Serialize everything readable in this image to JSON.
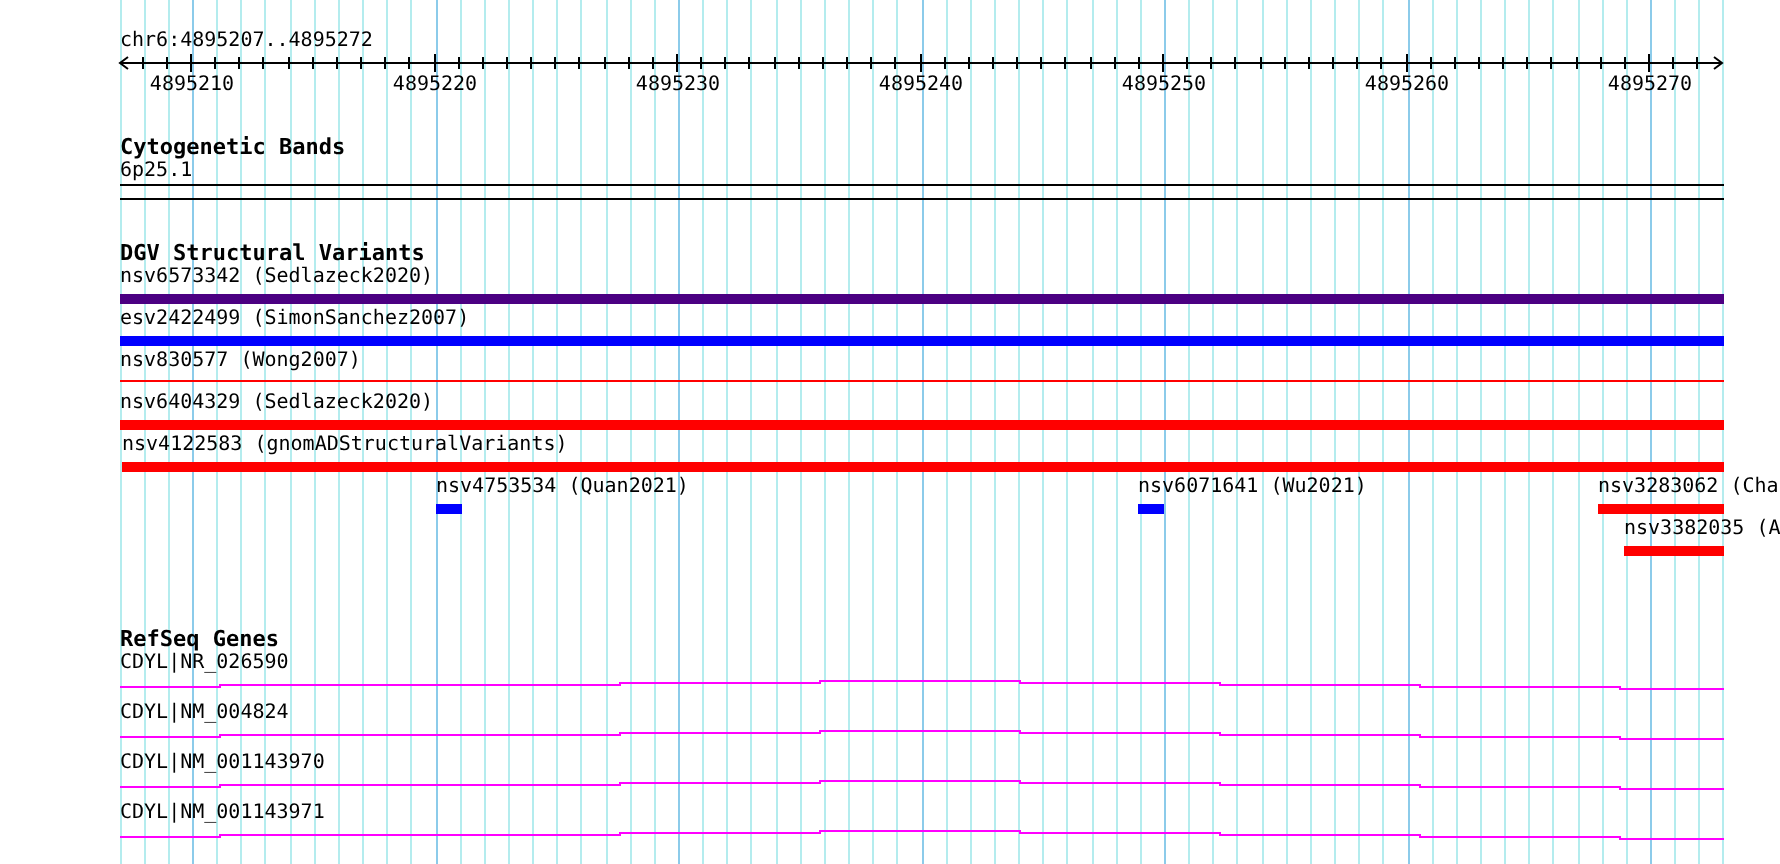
{
  "location": "chr6:4895207..4895272",
  "ruler": {
    "ticks": [
      "4895210",
      "4895220",
      "4895230",
      "4895240",
      "4895250",
      "4895260",
      "4895270"
    ]
  },
  "tracks": [
    {
      "kind": "bands",
      "title": "Cytogenetic Bands",
      "features": [
        {
          "label": "6p25.1"
        }
      ]
    },
    {
      "kind": "variants",
      "title": "DGV Structural Variants",
      "features": [
        {
          "label": "nsv6573342 (Sedlazeck2020)",
          "color": "#4b0082",
          "kind": "bar"
        },
        {
          "label": "esv2422499 (SimonSanchez2007)",
          "color": "#0000ff",
          "kind": "bar"
        },
        {
          "label": "nsv830577 (Wong2007)",
          "color": "#ff0000",
          "kind": "line"
        },
        {
          "label": "nsv6404329 (Sedlazeck2020)",
          "color": "#ff0000",
          "kind": "bar"
        },
        {
          "label": "nsv4122583 (gnomADStructuralVariants)",
          "color": "#ff0000",
          "kind": "bar"
        },
        {
          "label": "nsv4753534 (Quan2021)",
          "color": "#0000ff",
          "kind": "bar"
        },
        {
          "label": "nsv6071641 (Wu2021)",
          "color": "#0000ff",
          "kind": "bar"
        },
        {
          "label": "nsv3283062 (Cha",
          "color": "#ff0000",
          "kind": "bar"
        },
        {
          "label": "nsv3382035 (A",
          "color": "#ff0000",
          "kind": "bar"
        }
      ]
    },
    {
      "kind": "genes",
      "title": "RefSeq Genes",
      "features": [
        {
          "label": "CDYL|NR_026590"
        },
        {
          "label": "CDYL|NM_004824"
        },
        {
          "label": "CDYL|NM_001143970"
        },
        {
          "label": "CDYL|NM_001143971"
        }
      ]
    }
  ]
}
